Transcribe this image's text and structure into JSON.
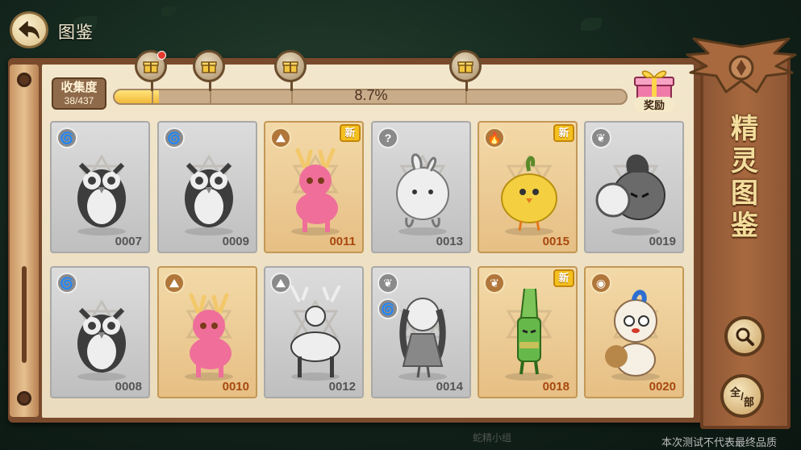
{
  "header": {
    "title": "图鉴",
    "back_icon": "back-arrow-icon"
  },
  "collection": {
    "label": "收集度",
    "count": "38/437",
    "percent_text": "8.7%",
    "progress": 0.087,
    "milestones": [
      {
        "icon": "gift-icon",
        "badge": true
      },
      {
        "icon": "gift-icon",
        "badge": false
      },
      {
        "icon": "gift-icon",
        "badge": false
      },
      {
        "icon": "gift-icon",
        "badge": false
      }
    ]
  },
  "reward": {
    "label": "奖励",
    "icon": "gift-box-icon"
  },
  "side": {
    "title_chars": [
      "精",
      "灵",
      "图",
      "鉴"
    ],
    "search_icon": "magnifier-icon",
    "filter_label_1": "全",
    "filter_label_2": "部"
  },
  "cards": [
    {
      "number": "0007",
      "state": "grey",
      "element": "wind",
      "element_glyph": "🌀",
      "new": false,
      "creature": "owl"
    },
    {
      "number": "0009",
      "state": "grey",
      "element": "wind",
      "element_glyph": "🌀",
      "new": false,
      "creature": "owl-armored"
    },
    {
      "number": "0011",
      "state": "gold",
      "element": "earth",
      "element_glyph": "⛰",
      "new": true,
      "creature": "deer-pink"
    },
    {
      "number": "0013",
      "state": "grey",
      "element": "unknown",
      "element_glyph": "?",
      "new": false,
      "creature": "blob"
    },
    {
      "number": "0015",
      "state": "gold",
      "element": "fire",
      "element_glyph": "🔥",
      "new": true,
      "creature": "chick"
    },
    {
      "number": "0019",
      "state": "grey",
      "element": "grass",
      "element_glyph": "❦",
      "new": false,
      "creature": "onion-knight"
    },
    {
      "number": "0008",
      "state": "grey",
      "element": "wind",
      "element_glyph": "🌀",
      "new": false,
      "creature": "owl-large"
    },
    {
      "number": "0010",
      "state": "gold",
      "element": "earth",
      "element_glyph": "⛰",
      "new": false,
      "creature": "deer-baby"
    },
    {
      "number": "0012",
      "state": "grey",
      "element": "earth",
      "element_glyph": "⛰",
      "new": false,
      "creature": "stag"
    },
    {
      "number": "0014",
      "state": "grey",
      "element": "grass",
      "element_glyph": "❦",
      "second_element_glyph": "🌀",
      "new": false,
      "creature": "flower-girl"
    },
    {
      "number": "0018",
      "state": "gold",
      "element": "grass",
      "element_glyph": "❦",
      "new": true,
      "creature": "leek"
    },
    {
      "number": "0020",
      "state": "gold",
      "element": "normal",
      "element_glyph": "◉",
      "new": false,
      "creature": "bear"
    }
  ],
  "new_badge": "新",
  "footer": {
    "watermark": "本次测试不代表最终品质",
    "logo_text": "蛇精小组"
  },
  "colors": {
    "gold_card": "#e6bf84",
    "grey_card": "#c8c8c8",
    "number_gold": "#a8480f",
    "number_grey": "#555555",
    "badge_red": "#e53a2f"
  }
}
